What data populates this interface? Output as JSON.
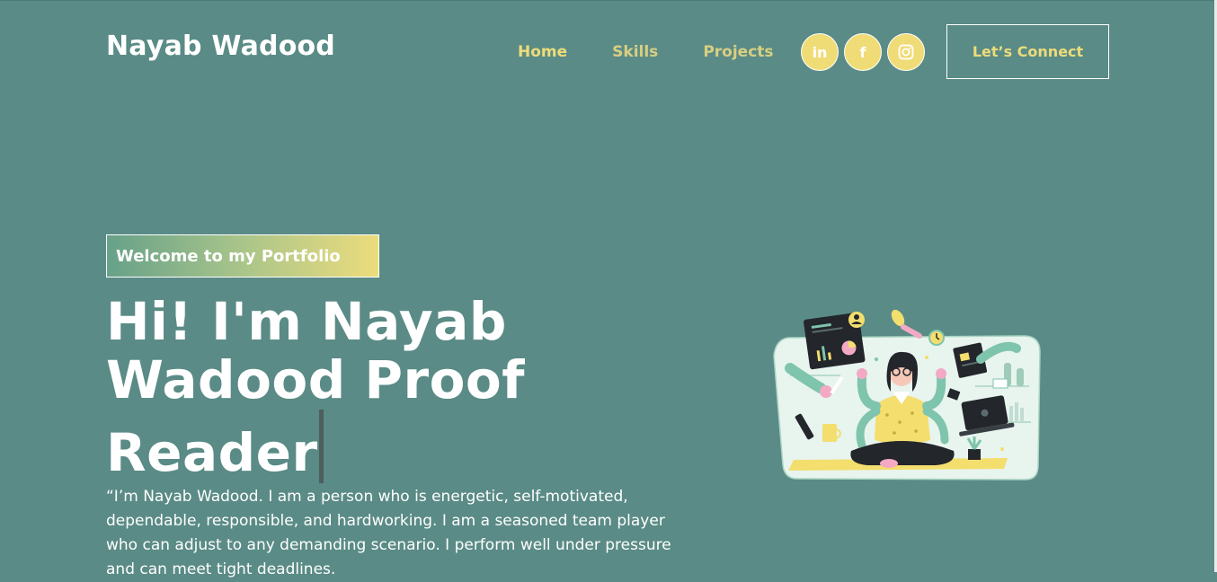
{
  "header": {
    "brand": "Nayab Wadood",
    "nav": [
      {
        "label": "Home"
      },
      {
        "label": "Skills"
      },
      {
        "label": "Projects"
      }
    ],
    "socials": [
      {
        "icon": "linkedin-icon",
        "glyph": "in"
      },
      {
        "icon": "facebook-icon",
        "glyph": "f"
      },
      {
        "icon": "instagram-icon",
        "glyph": "◎"
      }
    ],
    "connect_label": "Let’s Connect"
  },
  "hero": {
    "tagline": "Welcome to my Portfolio",
    "headline": "Hi! I'm Nayab Wadood Proof Reader",
    "bio": "“I’m Nayab Wadood. I am a person who is energetic, self-motivated, dependable, responsible, and hardworking. I am a seasoned team player who can adjust to any demanding scenario. I perform well under pressure and can meet tight deadlines."
  },
  "colors": {
    "background": "#5a8b86",
    "accent": "#eddc7a",
    "text": "#ffffff"
  }
}
